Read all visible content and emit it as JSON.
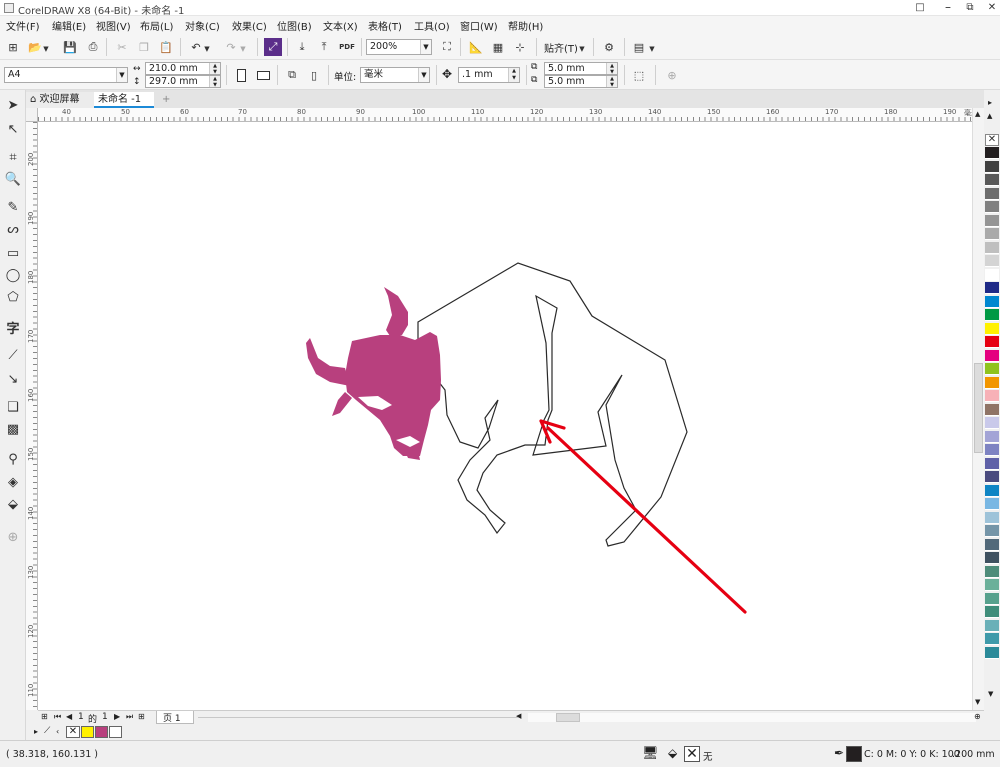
{
  "window": {
    "title": "CorelDRAW X8 (64-Bit) - 未命名 -1",
    "minimize": "□",
    "restore": "⧉",
    "close": "✕"
  },
  "menu": [
    "文件(F)",
    "编辑(E)",
    "视图(V)",
    "布局(L)",
    "对象(C)",
    "效果(C)",
    "位图(B)",
    "文本(X)",
    "表格(T)",
    "工具(O)",
    "窗口(W)",
    "帮助(H)"
  ],
  "toolbar": {
    "zoom": "200%",
    "snap": "贴齐(T)",
    "pdf_label": "PDF"
  },
  "property_bar": {
    "paper": "A4",
    "width": "210.0 mm",
    "height": "297.0 mm",
    "units_label": "单位:",
    "units": "毫米",
    "nudge": ".1 mm",
    "dup_x": "5.0 mm",
    "dup_y": "5.0 mm"
  },
  "tabs": [
    {
      "label": "欢迎屏幕"
    },
    {
      "label": "未命名 -1"
    }
  ],
  "ruler": {
    "h": [
      "40",
      "50",
      "60",
      "70",
      "80",
      "90",
      "100",
      "110",
      "120",
      "130",
      "140",
      "150",
      "160",
      "170",
      "180",
      "190"
    ],
    "h_unit": "毫米",
    "v": [
      "200",
      "190",
      "180",
      "170",
      "160",
      "150",
      "140",
      "130",
      "120",
      "110"
    ]
  },
  "pages": {
    "current": "1",
    "of_label": "的",
    "total": "1",
    "tab_label": "页 1"
  },
  "palette_colors": [
    "#231f20",
    "#404040",
    "#595959",
    "#6d6d6d",
    "#808080",
    "#959595",
    "#aaaaaa",
    "#bfbfbf",
    "#d4d4d4",
    "#ffffff",
    "#1f2a87",
    "#0087d0",
    "#009944",
    "#fff100",
    "#e60012",
    "#e4007f",
    "#8fc31f",
    "#f29600",
    "#f7b1b7",
    "#8f7466",
    "#c9c9ea",
    "#a3a4d6",
    "#7e83c2",
    "#5f61a8",
    "#4a4b7e",
    "#0f85c4",
    "#79b7e3",
    "#9ec3d9",
    "#7595a8",
    "#52697a",
    "#3f5160",
    "#4e8c7a",
    "#6bb09a",
    "#57a18d",
    "#3f8d7a",
    "#6ab0b8",
    "#3f9aaa",
    "#2b8a99"
  ],
  "doc_palette_colors": [
    "#fff100",
    "#b8407e",
    "#ffffff"
  ],
  "status": {
    "coords": "( 38.318, 160.131 )",
    "fill_none": "无",
    "outline_cmyk": "C: 0 M: 0 Y: 0 K: 100",
    "outline_width": ".200 mm"
  },
  "colors": {
    "bull_head": "#b8407e",
    "arrow": "#e60012",
    "outline_swatch": "#231f20"
  }
}
